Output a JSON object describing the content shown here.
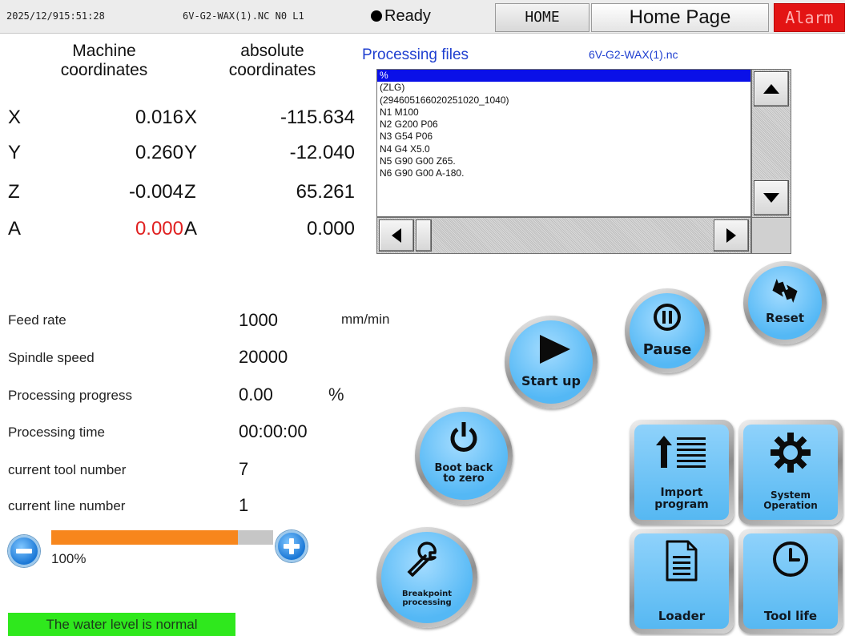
{
  "topbar": {
    "datetime": "2025/12/915:51:28",
    "program_status": "6V-G2-WAX(1).NC N0 L1",
    "ready_label": "Ready",
    "home_tab": "HOME",
    "page_title": "Home Page",
    "alarm_label": "Alarm"
  },
  "coordinates": {
    "machine_header": "Machine coordinates",
    "absolute_header": "absolute coordinates",
    "axes": [
      {
        "machine_axis": "X",
        "machine": "0.016",
        "abs_axis": "X",
        "absolute": "-115.634"
      },
      {
        "machine_axis": "Y",
        "machine": "0.260",
        "abs_axis": "Y",
        "absolute": "-12.040"
      },
      {
        "machine_axis": "Z",
        "machine": "-0.004",
        "abs_axis": "Z",
        "absolute": "65.261"
      },
      {
        "machine_axis": "A",
        "machine": "0.000",
        "abs_axis": "A",
        "absolute": "0.000"
      }
    ],
    "highlight_color": "#e02020"
  },
  "files": {
    "title": "Processing files",
    "filename": "6V-G2-WAX(1).nc",
    "lines": [
      "%",
      "(ZLG)",
      "(294605166020251020_1040)",
      "N1 M100",
      "N2 G200 P06",
      "N3 G54 P06",
      "N4 G4 X5.0",
      "N5 G90 G00 Z65.",
      "N6 G90 G00  A-180."
    ],
    "selected_index": 0,
    "selection_color": "#0a10e8"
  },
  "params": {
    "feed_rate": {
      "label": "Feed rate",
      "value": "1000",
      "unit": "mm/min"
    },
    "spindle_speed": {
      "label": "Spindle speed",
      "value": "20000"
    },
    "progress": {
      "label": "Processing progress",
      "value": "0.00",
      "unit": "%"
    },
    "time": {
      "label": "Processing time",
      "value": "00:00:00"
    },
    "tool": {
      "label": "current tool number",
      "value": "7"
    },
    "line": {
      "label": "current line number",
      "value": "1"
    }
  },
  "override": {
    "percent_label": "100%",
    "fill_fraction": 0.84,
    "fill_color": "#f7861c"
  },
  "water_status": "The water level is normal",
  "buttons": {
    "start_up": "Start up",
    "pause": "Pause",
    "reset": "Reset",
    "boot_back_line1": "Boot back",
    "boot_back_line2": "to zero",
    "breakpoint_line1": "Breakpoint",
    "breakpoint_line2": "processing",
    "import_line1": "Import",
    "import_line2": "program",
    "system_line1": "System",
    "system_line2": "Operation",
    "loader": "Loader",
    "tool_life": "Tool life"
  },
  "icons": {
    "start_up": "play-icon",
    "pause": "pause-icon",
    "reset": "reset-arrows-icon",
    "boot_back": "power-icon",
    "breakpoint": "wrench-icon",
    "import": "import-list-icon",
    "system": "gear-icon",
    "loader": "document-icon",
    "tool_life": "clock-icon"
  }
}
